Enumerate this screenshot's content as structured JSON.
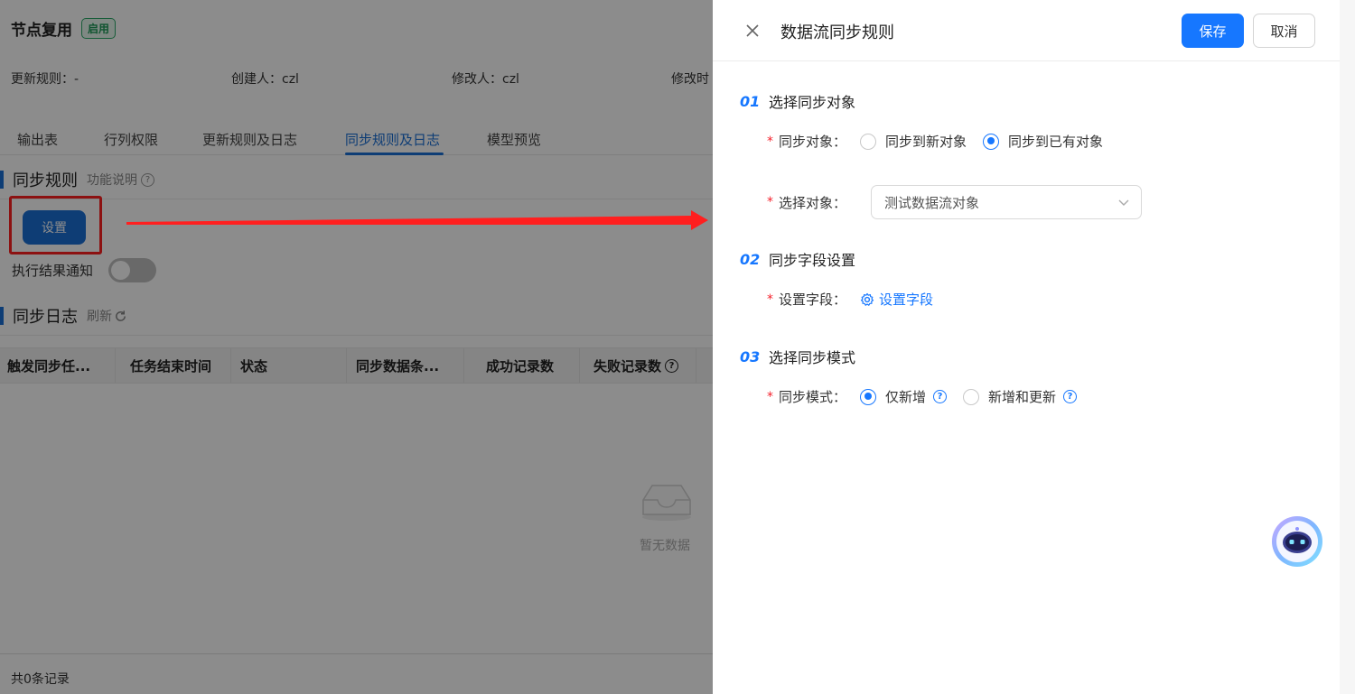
{
  "background": {
    "title": "节点复用",
    "status_badge": "启用",
    "meta": {
      "update_rule": "更新规则：-",
      "creator": "创建人：czl",
      "modifier": "修改人：czl",
      "modified_time": "修改时"
    },
    "tabs": [
      {
        "label": "输出表"
      },
      {
        "label": "行列权限"
      },
      {
        "label": "更新规则及日志"
      },
      {
        "label": "同步规则及日志",
        "active": true
      },
      {
        "label": "模型预览"
      }
    ],
    "sync_rules": {
      "heading": "同步规则",
      "help_label": "功能说明",
      "set_button": "设置",
      "notify_label": "执行结果通知",
      "notify_on": false
    },
    "sync_log": {
      "heading": "同步日志",
      "refresh_label": "刷新",
      "columns": [
        "触发同步任...",
        "任务结束时间",
        "状态",
        "同步数据条...",
        "成功记录数",
        "失败记录数"
      ],
      "empty_text": "暂无数据",
      "total": "共0条记录"
    }
  },
  "drawer": {
    "title": "数据流同步规则",
    "save_label": "保存",
    "cancel_label": "取消",
    "steps": [
      {
        "num": "01",
        "label": "选择同步对象"
      },
      {
        "num": "02",
        "label": "同步字段设置"
      },
      {
        "num": "03",
        "label": "选择同步模式"
      }
    ],
    "sync_target": {
      "label": "同步对象：",
      "options": [
        "同步到新对象",
        "同步到已有对象"
      ],
      "selected_index": 1
    },
    "select_target": {
      "label": "选择对象：",
      "value": "测试数据流对象"
    },
    "field_setting": {
      "label": "设置字段：",
      "link_label": "设置字段"
    },
    "sync_mode": {
      "label": "同步模式：",
      "options": [
        "仅新增",
        "新增和更新"
      ],
      "selected_index": 0
    }
  },
  "colors": {
    "primary": "#1677ff",
    "annotation_red": "#ff1f1f",
    "success_green": "#1e9a58"
  }
}
